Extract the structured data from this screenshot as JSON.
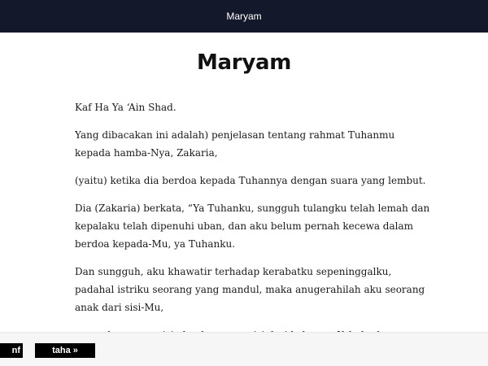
{
  "header": {
    "title": "Maryam"
  },
  "page": {
    "heading": "Maryam",
    "verses": [
      "Kaf Ha Ya ‘Ain Shad.",
      "Yang dibacakan ini adalah) penjelasan tentang rahmat Tuhanmu kepada hamba-Nya, Zakaria,",
      "(yaitu) ketika dia berdoa kepada Tuhannya dengan suara yang lembut.",
      "Dia (Zakaria) berkata, “Ya Tuhanku, sungguh tulangku telah lemah dan kepalaku telah dipenuhi uban, dan aku belum pernah kecewa dalam berdoa kepada-Mu, ya Tuhanku.",
      "Dan sungguh, aku khawatir terhadap kerabatku sepeninggalku, padahal istriku seorang yang mandul, maka anugerahilah aku seorang anak dari sisi-Mu,",
      "yang akan mewarisi aku dan mewarisi dari keluarga Yakub; dan jadikanlah dia, ya Tuhanku, seorang yang diridai.”"
    ]
  },
  "nav": {
    "prev_label": "nf",
    "next_label": "taha »"
  },
  "colors": {
    "topbar_bg": "#13182b",
    "button_bg": "#000000",
    "bottombar_bg": "#f6f6f6"
  }
}
